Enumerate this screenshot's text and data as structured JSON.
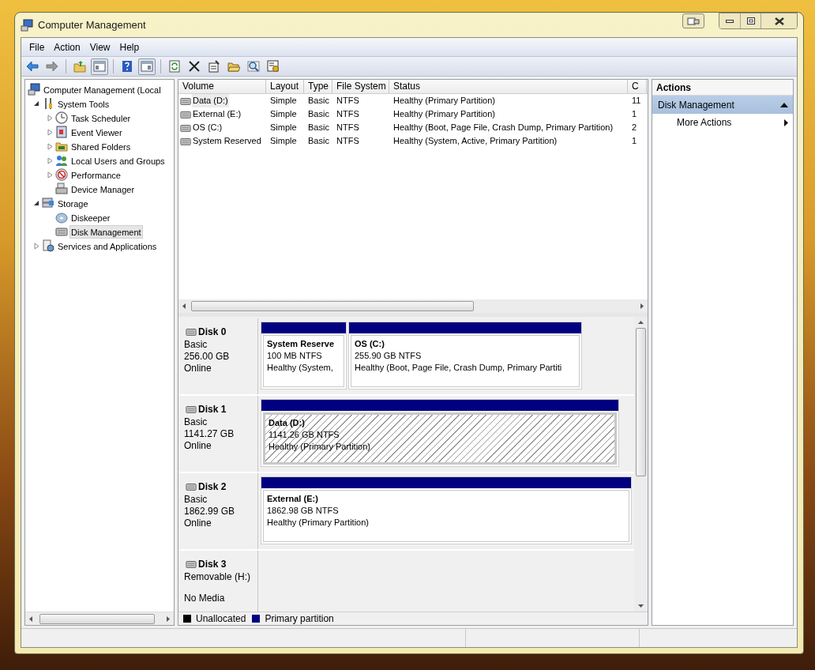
{
  "window": {
    "title": "Computer Management"
  },
  "menu": [
    "File",
    "Action",
    "View",
    "Help"
  ],
  "tree": [
    {
      "label": "Computer Management (Local",
      "selected": false,
      "children": [
        {
          "label": "System Tools",
          "expanded": true,
          "selected": false,
          "children": [
            {
              "label": "Task Scheduler",
              "expanded": false,
              "selected": false
            },
            {
              "label": "Event Viewer",
              "expanded": false,
              "selected": false
            },
            {
              "label": "Shared Folders",
              "expanded": false,
              "selected": false
            },
            {
              "label": "Local Users and Groups",
              "expanded": false,
              "selected": false
            },
            {
              "label": "Performance",
              "expanded": false,
              "selected": false
            },
            {
              "label": "Device Manager",
              "selected": false
            }
          ]
        },
        {
          "label": "Storage",
          "expanded": true,
          "selected": false,
          "children": [
            {
              "label": "Diskeeper",
              "selected": false
            },
            {
              "label": "Disk Management",
              "selected": true
            }
          ]
        },
        {
          "label": "Services and Applications",
          "expanded": false,
          "selected": false
        }
      ]
    }
  ],
  "volumes": {
    "columns": [
      "Volume",
      "Layout",
      "Type",
      "File System",
      "Status",
      "C"
    ],
    "rows": [
      {
        "cells": [
          "Data (D:)",
          "Simple",
          "Basic",
          "NTFS",
          "Healthy (Primary Partition)",
          "11"
        ],
        "selected": true
      },
      {
        "cells": [
          "External (E:)",
          "Simple",
          "Basic",
          "NTFS",
          "Healthy (Primary Partition)",
          "1"
        ],
        "selected": false
      },
      {
        "cells": [
          "OS (C:)",
          "Simple",
          "Basic",
          "NTFS",
          "Healthy (Boot, Page File, Crash Dump, Primary Partition)",
          "2"
        ],
        "selected": false
      },
      {
        "cells": [
          "System Reserved",
          "Simple",
          "Basic",
          "NTFS",
          "Healthy (System, Active, Primary Partition)",
          "1"
        ],
        "selected": false
      }
    ]
  },
  "disks": [
    {
      "name": "Disk 0",
      "lines": [
        "Basic",
        "256.00 GB"
      ],
      "status": "Online",
      "partitions": [
        {
          "label": "System Reserve",
          "size": "100 MB NTFS",
          "status": "Healthy (System,",
          "selected": false
        },
        {
          "label": "OS  (C:)",
          "size": "255.90 GB NTFS",
          "status": "Healthy (Boot, Page File, Crash Dump, Primary Partiti",
          "selected": false
        }
      ]
    },
    {
      "name": "Disk 1",
      "lines": [
        "Basic",
        "1141.27 GB"
      ],
      "status": "Online",
      "partitions": [
        {
          "label": "Data  (D:)",
          "size": "1141.26 GB NTFS",
          "status": "Healthy (Primary Partition)",
          "selected": true
        }
      ]
    },
    {
      "name": "Disk 2",
      "lines": [
        "Basic",
        "1862.99 GB"
      ],
      "status": "Online",
      "partitions": [
        {
          "label": "External  (E:)",
          "size": "1862.98 GB NTFS",
          "status": "Healthy (Primary Partition)",
          "selected": false
        }
      ]
    },
    {
      "name": "Disk 3",
      "lines": [
        "Removable (H:)"
      ],
      "status": "No Media"
    }
  ],
  "legend": [
    {
      "label": "Unallocated",
      "color": "#000000"
    },
    {
      "label": "Primary partition",
      "color": "#000080"
    }
  ],
  "actions": {
    "title": "Actions",
    "sections": [
      {
        "label": "Disk Management",
        "expanded": true,
        "items": [
          "More Actions"
        ]
      }
    ]
  }
}
